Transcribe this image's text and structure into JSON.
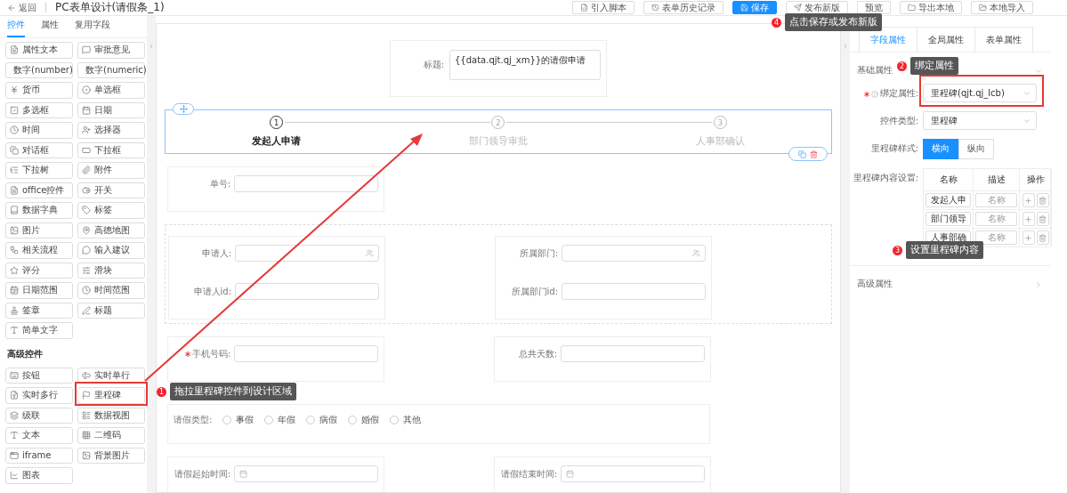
{
  "header": {
    "back": "返回",
    "title": "PC表单设计(请假条_1)"
  },
  "toolbar": [
    {
      "label": "引入脚本",
      "primary": false
    },
    {
      "label": "表单历史记录",
      "primary": false
    },
    {
      "label": "保存",
      "primary": true
    },
    {
      "label": "发布新版",
      "primary": false
    },
    {
      "label": "预览",
      "primary": false
    },
    {
      "label": "导出本地",
      "primary": false
    },
    {
      "label": "本地导入",
      "primary": false
    }
  ],
  "left_panel": {
    "tabs": [
      {
        "label": "控件",
        "selected": true
      },
      {
        "label": "属性",
        "selected": false
      },
      {
        "label": "复用字段",
        "selected": false
      }
    ],
    "basic_controls": [
      "属性文本",
      "审批意见",
      "数字(number)",
      "数字(numeric)",
      "货币",
      "单选框",
      "多选框",
      "日期",
      "时间",
      "选择器",
      "对话框",
      "下拉框",
      "下拉树",
      "附件",
      "office控件",
      "开关",
      "数据字典",
      "标签",
      "图片",
      "高德地图",
      "相关流程",
      "输入建议",
      "评分",
      "滑块",
      "日期范围",
      "时间范围",
      "签章",
      "标题",
      "简单文字"
    ],
    "advanced_title": "高级控件",
    "advanced_controls": [
      "按钮",
      "实时单行",
      "实时多行",
      "里程碑",
      "级联",
      "数据视图",
      "文本",
      "二维码",
      "iframe",
      "背景图片",
      "图表"
    ]
  },
  "canvas": {
    "title_field": {
      "label": "标题:",
      "value": "{{data.qjt.qj_xm}}的请假申请"
    },
    "milestone": {
      "selected": true,
      "steps": [
        {
          "number": "1",
          "label": "发起人申请",
          "active": true
        },
        {
          "number": "2",
          "label": "部门领导审批",
          "active": false
        },
        {
          "number": "3",
          "label": "人事部确认",
          "active": false
        }
      ]
    },
    "sections": [
      {
        "kind": "cards",
        "grouped": false,
        "cards": [
          {
            "fields": [
              {
                "label": "单号:",
                "required": false,
                "kind": "text"
              }
            ]
          }
        ]
      },
      {
        "kind": "cards",
        "grouped": true,
        "cards": [
          {
            "fields": [
              {
                "label": "申请人:",
                "required": false,
                "kind": "user_picker"
              },
              {
                "label": "申请人id:",
                "required": false,
                "kind": "text"
              }
            ]
          },
          {
            "fields": [
              {
                "label": "所属部门:",
                "required": false,
                "kind": "user_picker"
              },
              {
                "label": "所属部门id:",
                "required": false,
                "kind": "text"
              }
            ]
          }
        ]
      },
      {
        "kind": "cards",
        "grouped": false,
        "cards": [
          {
            "fields": [
              {
                "label": "手机号码:",
                "required": true,
                "kind": "text"
              }
            ]
          },
          {
            "fields": [
              {
                "label": "总共天数:",
                "required": false,
                "kind": "text"
              }
            ]
          }
        ]
      },
      {
        "kind": "radio",
        "label": "请假类型:",
        "options": [
          {
            "label": "事假",
            "selected": false
          },
          {
            "label": "年假",
            "selected": false
          },
          {
            "label": "病假",
            "selected": false
          },
          {
            "label": "婚假",
            "selected": false
          },
          {
            "label": "其他",
            "selected": false
          }
        ]
      },
      {
        "kind": "cards",
        "grouped": false,
        "cards": [
          {
            "fields": [
              {
                "label": "请假起始时间:",
                "required": false,
                "kind": "date"
              }
            ]
          },
          {
            "fields": [
              {
                "label": "请假结束时间:",
                "required": false,
                "kind": "date"
              }
            ]
          }
        ]
      }
    ]
  },
  "right_panel": {
    "tabs": [
      {
        "label": "字段属性",
        "selected": true
      },
      {
        "label": "全局属性",
        "selected": false
      },
      {
        "label": "表单属性",
        "selected": false
      }
    ],
    "basic_section": {
      "title": "基础属性",
      "expanded": true,
      "fields": [
        {
          "kind": "select",
          "label": "绑定属性:",
          "required": true,
          "info": true,
          "value": "里程碑(qjt.qj_lcb)"
        },
        {
          "kind": "select",
          "label": "控件类型:",
          "required": false,
          "info": false,
          "value": "里程碑"
        },
        {
          "kind": "segmented",
          "label": "里程碑样式:",
          "options": [
            {
              "label": "横向",
              "selected": true
            },
            {
              "label": "纵向",
              "selected": false
            }
          ]
        },
        {
          "kind": "table",
          "label": "里程碑内容设置:",
          "columns": [
            "名称",
            "描述",
            "操作"
          ],
          "rows": [
            {
              "name": "发起人申",
              "description_placeholder": "名称"
            },
            {
              "name": "部门领导",
              "description_placeholder": "名称"
            },
            {
              "name": "人事部确",
              "description_placeholder": "名称"
            }
          ]
        }
      ]
    },
    "advanced_section": {
      "title": "高级属性",
      "expanded": false
    }
  },
  "annotations": [
    {
      "number": "1",
      "text": "拖拉里程碑控件到设计区域"
    },
    {
      "number": "2",
      "text": "绑定属性"
    },
    {
      "number": "3",
      "text": "设置里程碑内容"
    },
    {
      "number": "4",
      "text": "点击保存或发布新版"
    }
  ]
}
